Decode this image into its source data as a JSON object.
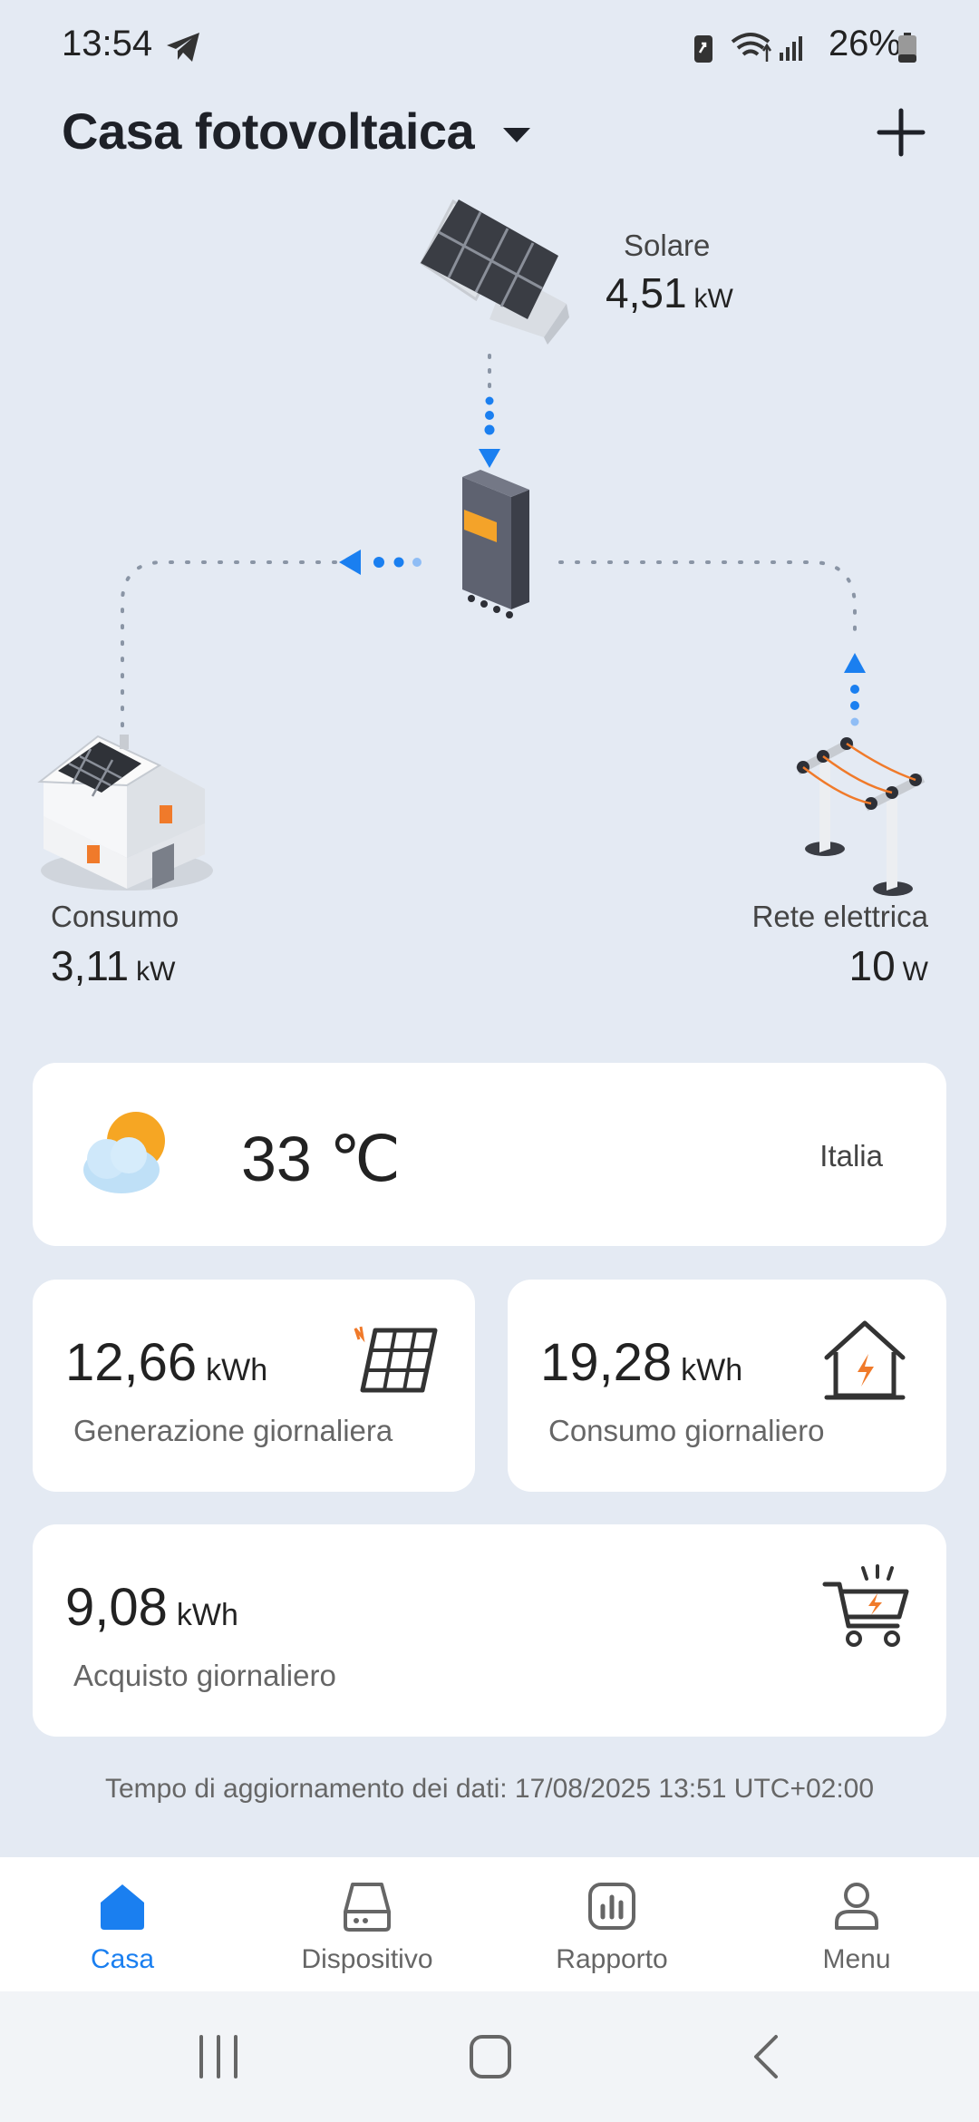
{
  "status": {
    "time": "13:54",
    "battery": "26%"
  },
  "header": {
    "title": "Casa fotovoltaica",
    "dropdown_icon": "caret-down-icon",
    "add_icon": "plus-icon"
  },
  "flow": {
    "solar": {
      "label": "Solare",
      "value": "4,51",
      "unit": "kW"
    },
    "consumption": {
      "label": "Consumo",
      "value": "3,11",
      "unit": "kW"
    },
    "grid": {
      "label": "Rete elettrica",
      "value": "10",
      "unit": "W"
    }
  },
  "weather": {
    "temperature": "33 ℃",
    "location": "Italia",
    "icon": "partly-cloudy-icon"
  },
  "stats": {
    "generation": {
      "value": "12,66",
      "unit": "kWh",
      "label": "Generazione giornaliera"
    },
    "consumption": {
      "value": "19,28",
      "unit": "kWh",
      "label": "Consumo giornaliero"
    },
    "purchase": {
      "value": "9,08",
      "unit": "kWh",
      "label": "Acquisto giornaliero"
    }
  },
  "update_text": "Tempo di aggiornamento dei dati: 17/08/2025 13:51 UTC+02:00",
  "nav": [
    {
      "label": "Casa",
      "icon": "home-icon"
    },
    {
      "label": "Dispositivo",
      "icon": "device-icon"
    },
    {
      "label": "Rapporto",
      "icon": "report-icon"
    },
    {
      "label": "Menu",
      "icon": "user-icon"
    }
  ],
  "colors": {
    "accent": "#1a7ff0",
    "background": "#e4eaf3",
    "orange": "#f07a2a"
  }
}
